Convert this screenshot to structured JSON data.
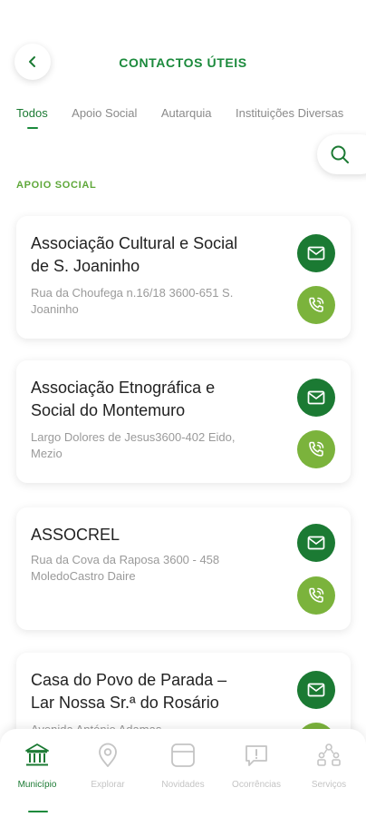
{
  "header": {
    "title": "CONTACTOS ÚTEIS",
    "back_icon": "chevron-left-icon"
  },
  "tabs": [
    {
      "label": "Todos",
      "active": true
    },
    {
      "label": "Apoio Social",
      "active": false
    },
    {
      "label": "Autarquia",
      "active": false
    },
    {
      "label": "Instituições Diversas",
      "active": false
    }
  ],
  "search": {
    "icon": "search-icon"
  },
  "section": {
    "label": "APOIO SOCIAL"
  },
  "contacts": [
    {
      "name": "Associação Cultural e Social de S. Joaninho",
      "address": "Rua da Choufega n.16/18 3600-651 S. Joaninho"
    },
    {
      "name": "Associação Etnográfica e Social do Montemuro",
      "address": "Largo Dolores de Jesus3600-402 Eido, Mezio"
    },
    {
      "name": "ASSOCREL",
      "address": "Rua da Cova da Raposa 3600 - 458 MoledoCastro Daire"
    },
    {
      "name": "Casa do Povo de Parada – Lar Nossa Sr.ª do Rosário",
      "address": "Avenida António Adamas"
    }
  ],
  "bottom_nav": [
    {
      "label": "Município",
      "icon": "bank-icon",
      "active": true
    },
    {
      "label": "Explorar",
      "icon": "map-pin-icon",
      "active": false
    },
    {
      "label": "Novidades",
      "icon": "news-card-icon",
      "active": false
    },
    {
      "label": "Ocorrências",
      "icon": "alert-message-icon",
      "active": false
    },
    {
      "label": "Serviços",
      "icon": "services-icon",
      "active": false
    }
  ],
  "colors": {
    "primary": "#1b7a33",
    "secondary": "#7bb33c",
    "title": "#1b8a3c"
  }
}
